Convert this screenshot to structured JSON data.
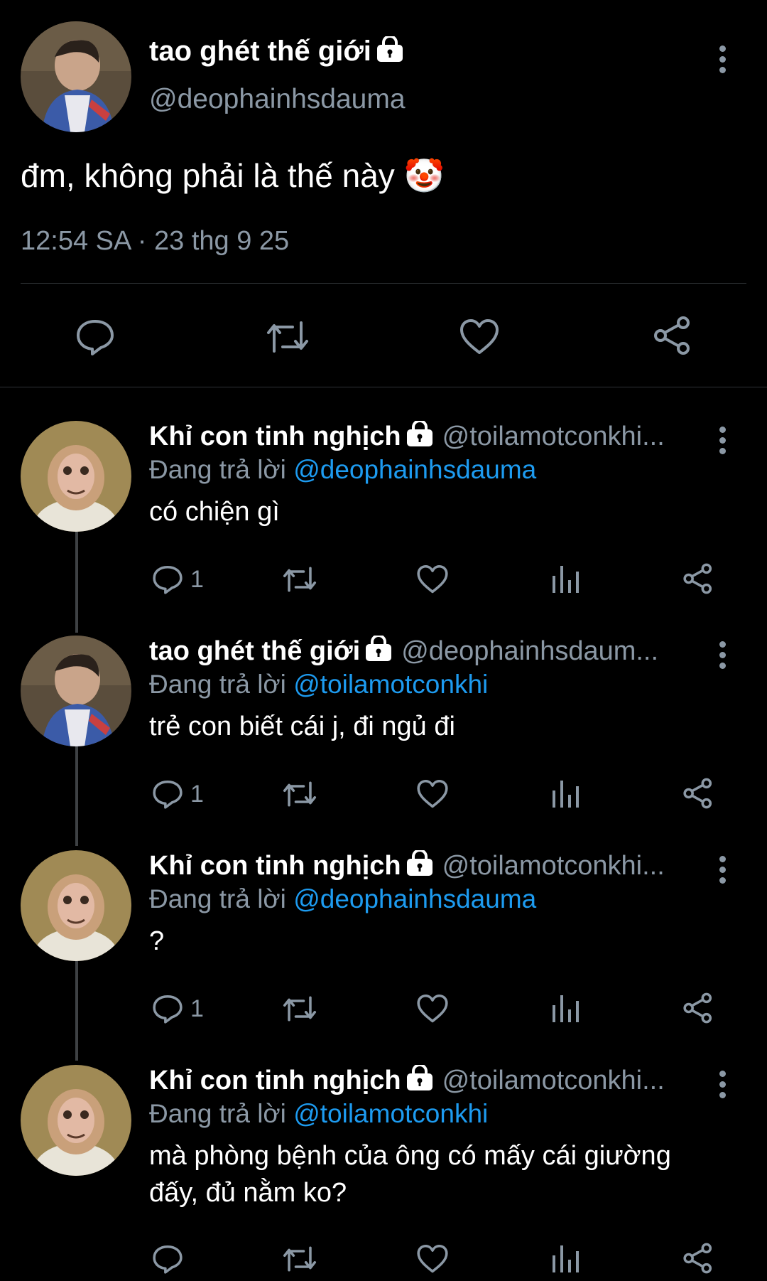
{
  "main_tweet": {
    "name": "tao ghét thế giới",
    "handle": "@deophainhsdauma",
    "text": "đm, không phải là thế này 🤡",
    "timestamp": "12:54 SA · 23 thg 9 25"
  },
  "replies": [
    {
      "name": "Khỉ con tinh nghịch",
      "handle": "@toilamotconkhi...",
      "replying_prefix": "Đang trả lời ",
      "replying_to": "@deophainhsdauma",
      "text": "có chiện gì",
      "reply_count": "1"
    },
    {
      "name": "tao ghét thế giới",
      "handle": "@deophainhsdaum...",
      "replying_prefix": "Đang trả lời ",
      "replying_to": "@toilamotconkhi",
      "text": "trẻ con biết cái j, đi ngủ đi",
      "reply_count": "1"
    },
    {
      "name": "Khỉ con tinh nghịch",
      "handle": "@toilamotconkhi...",
      "replying_prefix": "Đang trả lời ",
      "replying_to": "@deophainhsdauma",
      "text": "?",
      "reply_count": "1"
    },
    {
      "name": "Khỉ con tinh nghịch",
      "handle": "@toilamotconkhi...",
      "replying_prefix": "Đang trả lời ",
      "replying_to": "@toilamotconkhi",
      "text": "mà phòng bệnh của ông có mấy cái giường đấy, đủ nằm ko?",
      "reply_count": ""
    }
  ],
  "colors": {
    "background": "#000000",
    "text": "#e7e9ea",
    "secondary": "#8b98a5",
    "link": "#1d9bf0",
    "divider": "#2f3336"
  },
  "icons": [
    "reply-icon",
    "retweet-icon",
    "like-icon",
    "share-icon",
    "views-icon",
    "lock-icon",
    "more-icon"
  ]
}
